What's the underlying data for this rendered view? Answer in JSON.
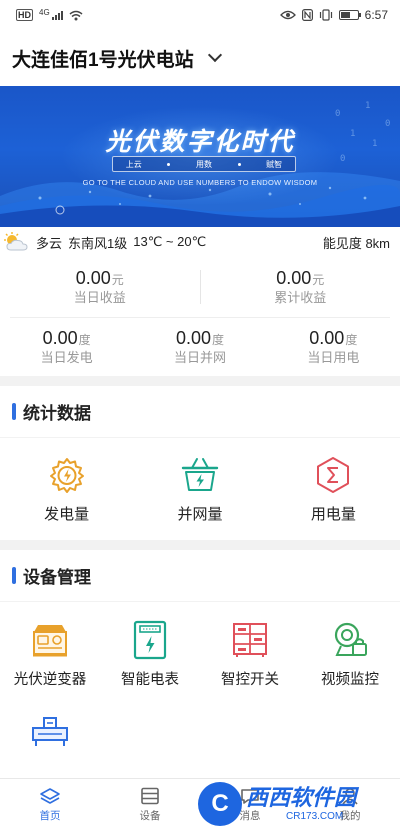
{
  "status_bar": {
    "left_badge": "HD",
    "signal": "4G",
    "time": "6:57"
  },
  "header": {
    "station_name": "大连佳佰1号光伏电站"
  },
  "banner": {
    "title": "光伏数字化时代",
    "tags": [
      "上云",
      "用数",
      "赋智"
    ],
    "subtitle": "GO TO THE CLOUD AND USE NUMBERS TO ENDOW WISDOM"
  },
  "weather": {
    "icon": "partly-cloudy-icon",
    "condition": "多云",
    "wind": "东南风1级",
    "temp_range": "13℃ ~ 20℃",
    "visibility": "能见度 8km"
  },
  "earnings": [
    {
      "value": "0.00",
      "unit": "元",
      "label": "当日收益"
    },
    {
      "value": "0.00",
      "unit": "元",
      "label": "累计收益"
    }
  ],
  "power": [
    {
      "value": "0.00",
      "unit": "度",
      "label": "当日发电"
    },
    {
      "value": "0.00",
      "unit": "度",
      "label": "当日并网"
    },
    {
      "value": "0.00",
      "unit": "度",
      "label": "当日用电"
    }
  ],
  "stats_section": {
    "title": "统计数据",
    "items": [
      {
        "label": "发电量",
        "icon": "gear-bolt-icon",
        "color": "#e8a12b"
      },
      {
        "label": "并网量",
        "icon": "basket-bolt-icon",
        "color": "#1aa68c"
      },
      {
        "label": "用电量",
        "icon": "hexagon-sigma-icon",
        "color": "#e0505a"
      }
    ]
  },
  "device_section": {
    "title": "设备管理",
    "items": [
      {
        "label": "光伏逆变器",
        "icon": "inverter-icon",
        "color": "#e8a12b"
      },
      {
        "label": "智能电表",
        "icon": "smart-meter-icon",
        "color": "#1aa68c"
      },
      {
        "label": "智控开关",
        "icon": "switch-cabinet-icon",
        "color": "#e0505a"
      },
      {
        "label": "视频监控",
        "icon": "camera-icon",
        "color": "#3aa55c"
      },
      {
        "label": "",
        "icon": "machine-icon",
        "color": "#2f6fe0"
      }
    ]
  },
  "tabbar": {
    "tabs": [
      {
        "label": "首页",
        "icon": "home-layers-icon",
        "active": true
      },
      {
        "label": "设备",
        "icon": "device-icon",
        "active": false
      },
      {
        "label": "消息",
        "icon": "message-icon",
        "active": false
      },
      {
        "label": "我的",
        "icon": "user-icon",
        "active": false
      }
    ]
  },
  "watermark": {
    "name": "西西软件园",
    "url": "CR173.COM"
  },
  "colors": {
    "accent": "#2f6fe0",
    "banner": "#1d61d6"
  }
}
